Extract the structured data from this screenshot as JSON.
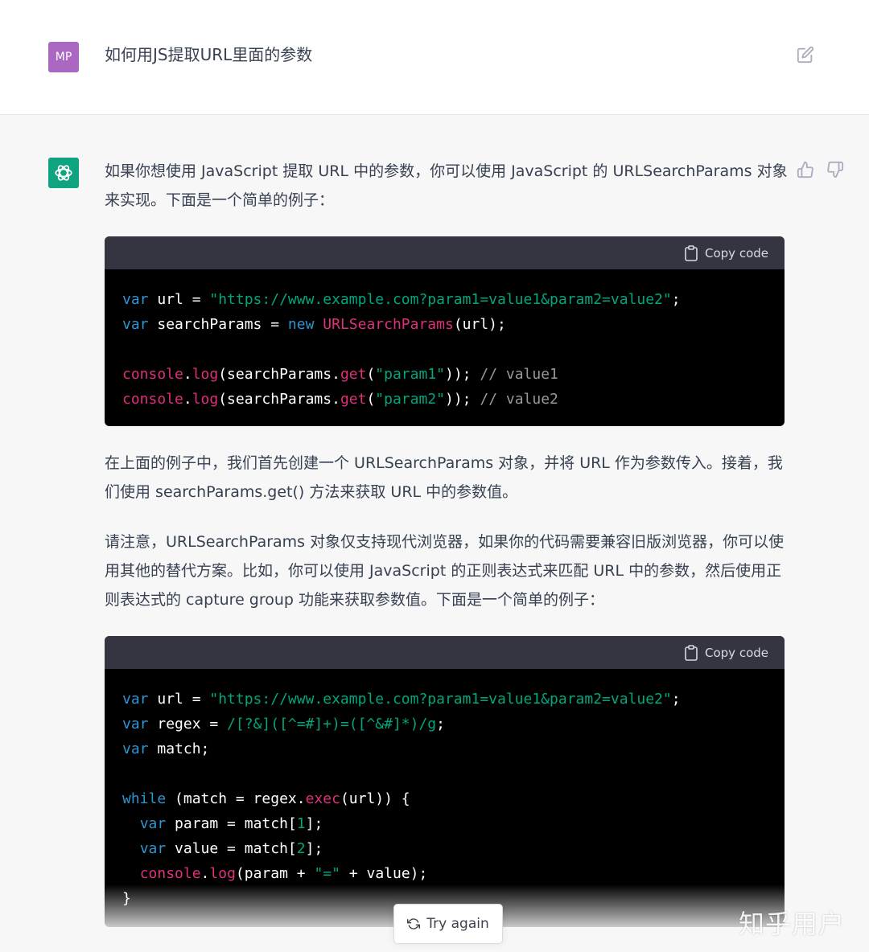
{
  "user": {
    "avatar_initials": "MP",
    "message": "如何用JS提取URL里面的参数"
  },
  "icons": {
    "edit": "edit-icon",
    "bot": "openai-logo-icon",
    "thumb_up": "thumbs-up-icon",
    "thumb_down": "thumbs-down-icon",
    "copy": "clipboard-icon",
    "refresh": "refresh-icon"
  },
  "colors": {
    "user_avatar": "#ab68c2",
    "bot_avatar": "#10a37f",
    "keyword": "#2e95d3",
    "string": "#00a67d",
    "function": "#df3079",
    "comment": "#999999"
  },
  "assistant": {
    "intro": "如果你想使用 JavaScript 提取 URL 中的参数，你可以使用 JavaScript 的 URLSearchParams 对象来实现。下面是一个简单的例子：",
    "explain1": "在上面的例子中，我们首先创建一个 URLSearchParams 对象，并将 URL 作为参数传入。接着，我们使用 searchParams.get() 方法来获取 URL 中的参数值。",
    "explain2": "请注意，URLSearchParams 对象仅支持现代浏览器，如果你的代码需要兼容旧版浏览器，你可以使用其他的替代方案。比如，你可以使用 JavaScript 的正则表达式来匹配 URL 中的参数，然后使用正则表达式的 capture group 功能来获取参数值。下面是一个简单的例子："
  },
  "code_blocks": [
    {
      "copy_label": "Copy code",
      "lines": [
        [
          [
            "kw",
            "var"
          ],
          [
            "pl",
            " url = "
          ],
          [
            "str",
            "\"https://www.example.com?param1=value1&param2=value2\""
          ],
          [
            "pl",
            ";"
          ]
        ],
        [
          [
            "kw",
            "var"
          ],
          [
            "pl",
            " searchParams = "
          ],
          [
            "kw",
            "new"
          ],
          [
            "pl",
            " "
          ],
          [
            "fn",
            "URLSearchParams"
          ],
          [
            "pl",
            "(url);"
          ]
        ],
        [],
        [
          [
            "fn",
            "console"
          ],
          [
            "pl",
            "."
          ],
          [
            "fn",
            "log"
          ],
          [
            "pl",
            "(searchParams."
          ],
          [
            "fn",
            "get"
          ],
          [
            "pl",
            "("
          ],
          [
            "str",
            "\"param1\""
          ],
          [
            "pl",
            "));"
          ],
          [
            "pl",
            " "
          ],
          [
            "cm",
            "// value1"
          ]
        ],
        [
          [
            "fn",
            "console"
          ],
          [
            "pl",
            "."
          ],
          [
            "fn",
            "log"
          ],
          [
            "pl",
            "(searchParams."
          ],
          [
            "fn",
            "get"
          ],
          [
            "pl",
            "("
          ],
          [
            "str",
            "\"param2\""
          ],
          [
            "pl",
            "));"
          ],
          [
            "pl",
            " "
          ],
          [
            "cm",
            "// value2"
          ]
        ]
      ]
    },
    {
      "copy_label": "Copy code",
      "lines": [
        [
          [
            "kw",
            "var"
          ],
          [
            "pl",
            " url = "
          ],
          [
            "str",
            "\"https://www.example.com?param1=value1&param2=value2\""
          ],
          [
            "pl",
            ";"
          ]
        ],
        [
          [
            "kw",
            "var"
          ],
          [
            "pl",
            " regex = "
          ],
          [
            "str",
            "/[?&]([^=#]+)=([^&#]*)/g"
          ],
          [
            "pl",
            ";"
          ]
        ],
        [
          [
            "kw",
            "var"
          ],
          [
            "pl",
            " match;"
          ]
        ],
        [],
        [
          [
            "kw",
            "while"
          ],
          [
            "pl",
            " (match = regex."
          ],
          [
            "fn",
            "exec"
          ],
          [
            "pl",
            "(url)) {"
          ]
        ],
        [
          [
            "pl",
            "  "
          ],
          [
            "kw",
            "var"
          ],
          [
            "pl",
            " param = match["
          ],
          [
            "str",
            "1"
          ],
          [
            "pl",
            "];"
          ]
        ],
        [
          [
            "pl",
            "  "
          ],
          [
            "kw",
            "var"
          ],
          [
            "pl",
            " value = match["
          ],
          [
            "str",
            "2"
          ],
          [
            "pl",
            "];"
          ]
        ],
        [
          [
            "pl",
            "  "
          ],
          [
            "fn",
            "console"
          ],
          [
            "pl",
            "."
          ],
          [
            "fn",
            "log"
          ],
          [
            "pl",
            "(param + "
          ],
          [
            "str",
            "\"=\""
          ],
          [
            "pl",
            " + value);"
          ]
        ],
        [
          [
            "pl",
            "}"
          ]
        ]
      ]
    }
  ],
  "try_again_label": "Try again",
  "watermark": "知乎用户"
}
